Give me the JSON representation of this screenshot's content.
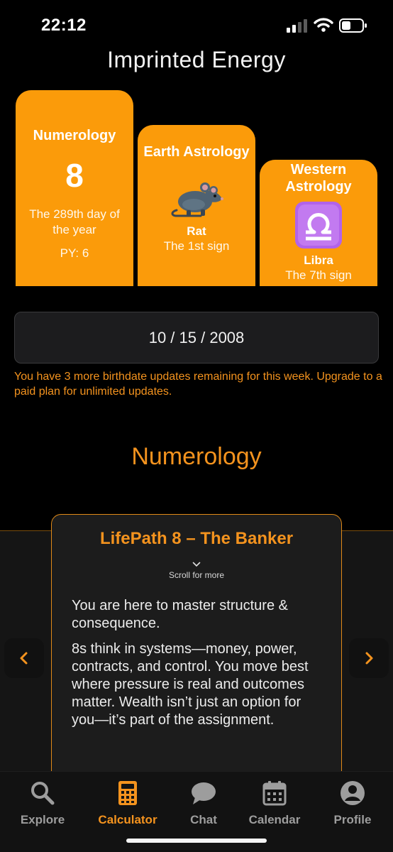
{
  "status_bar": {
    "time": "22:12"
  },
  "page_title": "Imprinted Energy",
  "cards": {
    "numerology": {
      "title": "Numerology",
      "number": "8",
      "description": "The 289th day of the year",
      "py": "PY: 6"
    },
    "earth": {
      "title": "Earth Astrology",
      "icon": "rat-icon",
      "sign": "Rat",
      "subtitle": "The 1st sign"
    },
    "western": {
      "title": "Western Astrology",
      "icon": "libra-icon",
      "sign": "Libra",
      "subtitle": "The 7th sign"
    }
  },
  "birthdate": {
    "value": "10 / 15 / 2008"
  },
  "notice": "You have 3 more birthdate updates remaining for this week. Upgrade to a paid plan for unlimited updates.",
  "section_title": "Numerology",
  "lifepath": {
    "title": "LifePath 8 – The Banker",
    "scroll_hint": "Scroll for more",
    "paragraphs": [
      "You are here to master structure & consequence.",
      "8s think in systems—money, power, contracts, and control. You move best where pressure is real and outcomes matter. Wealth isn’t just an option for you—it’s part of the assignment."
    ]
  },
  "tabs": [
    {
      "label": "Explore",
      "icon": "search-icon"
    },
    {
      "label": "Calculator",
      "icon": "calculator-icon",
      "active": true
    },
    {
      "label": "Chat",
      "icon": "chat-icon"
    },
    {
      "label": "Calendar",
      "icon": "calendar-icon"
    },
    {
      "label": "Profile",
      "icon": "profile-icon"
    }
  ],
  "colors": {
    "accent": "#f4931e",
    "card": "#fb9b0a",
    "libra": "#b263ea",
    "background": "#000000"
  }
}
